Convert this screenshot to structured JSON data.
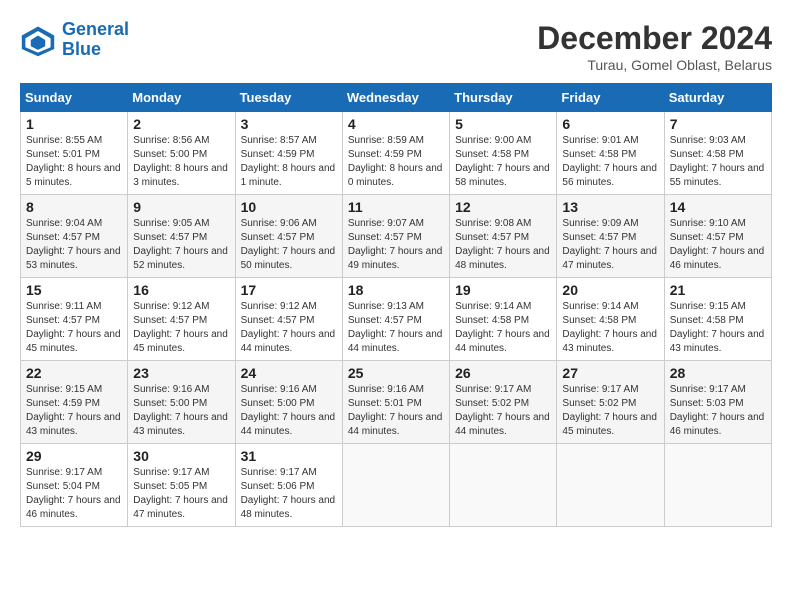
{
  "header": {
    "logo_line1": "General",
    "logo_line2": "Blue",
    "month": "December 2024",
    "location": "Turau, Gomel Oblast, Belarus"
  },
  "days_of_week": [
    "Sunday",
    "Monday",
    "Tuesday",
    "Wednesday",
    "Thursday",
    "Friday",
    "Saturday"
  ],
  "weeks": [
    [
      {
        "day": "1",
        "sunrise": "8:55 AM",
        "sunset": "5:01 PM",
        "daylight": "8 hours and 5 minutes."
      },
      {
        "day": "2",
        "sunrise": "8:56 AM",
        "sunset": "5:00 PM",
        "daylight": "8 hours and 3 minutes."
      },
      {
        "day": "3",
        "sunrise": "8:57 AM",
        "sunset": "4:59 PM",
        "daylight": "8 hours and 1 minute."
      },
      {
        "day": "4",
        "sunrise": "8:59 AM",
        "sunset": "4:59 PM",
        "daylight": "8 hours and 0 minutes."
      },
      {
        "day": "5",
        "sunrise": "9:00 AM",
        "sunset": "4:58 PM",
        "daylight": "7 hours and 58 minutes."
      },
      {
        "day": "6",
        "sunrise": "9:01 AM",
        "sunset": "4:58 PM",
        "daylight": "7 hours and 56 minutes."
      },
      {
        "day": "7",
        "sunrise": "9:03 AM",
        "sunset": "4:58 PM",
        "daylight": "7 hours and 55 minutes."
      }
    ],
    [
      {
        "day": "8",
        "sunrise": "9:04 AM",
        "sunset": "4:57 PM",
        "daylight": "7 hours and 53 minutes."
      },
      {
        "day": "9",
        "sunrise": "9:05 AM",
        "sunset": "4:57 PM",
        "daylight": "7 hours and 52 minutes."
      },
      {
        "day": "10",
        "sunrise": "9:06 AM",
        "sunset": "4:57 PM",
        "daylight": "7 hours and 50 minutes."
      },
      {
        "day": "11",
        "sunrise": "9:07 AM",
        "sunset": "4:57 PM",
        "daylight": "7 hours and 49 minutes."
      },
      {
        "day": "12",
        "sunrise": "9:08 AM",
        "sunset": "4:57 PM",
        "daylight": "7 hours and 48 minutes."
      },
      {
        "day": "13",
        "sunrise": "9:09 AM",
        "sunset": "4:57 PM",
        "daylight": "7 hours and 47 minutes."
      },
      {
        "day": "14",
        "sunrise": "9:10 AM",
        "sunset": "4:57 PM",
        "daylight": "7 hours and 46 minutes."
      }
    ],
    [
      {
        "day": "15",
        "sunrise": "9:11 AM",
        "sunset": "4:57 PM",
        "daylight": "7 hours and 45 minutes."
      },
      {
        "day": "16",
        "sunrise": "9:12 AM",
        "sunset": "4:57 PM",
        "daylight": "7 hours and 45 minutes."
      },
      {
        "day": "17",
        "sunrise": "9:12 AM",
        "sunset": "4:57 PM",
        "daylight": "7 hours and 44 minutes."
      },
      {
        "day": "18",
        "sunrise": "9:13 AM",
        "sunset": "4:57 PM",
        "daylight": "7 hours and 44 minutes."
      },
      {
        "day": "19",
        "sunrise": "9:14 AM",
        "sunset": "4:58 PM",
        "daylight": "7 hours and 44 minutes."
      },
      {
        "day": "20",
        "sunrise": "9:14 AM",
        "sunset": "4:58 PM",
        "daylight": "7 hours and 43 minutes."
      },
      {
        "day": "21",
        "sunrise": "9:15 AM",
        "sunset": "4:58 PM",
        "daylight": "7 hours and 43 minutes."
      }
    ],
    [
      {
        "day": "22",
        "sunrise": "9:15 AM",
        "sunset": "4:59 PM",
        "daylight": "7 hours and 43 minutes."
      },
      {
        "day": "23",
        "sunrise": "9:16 AM",
        "sunset": "5:00 PM",
        "daylight": "7 hours and 43 minutes."
      },
      {
        "day": "24",
        "sunrise": "9:16 AM",
        "sunset": "5:00 PM",
        "daylight": "7 hours and 44 minutes."
      },
      {
        "day": "25",
        "sunrise": "9:16 AM",
        "sunset": "5:01 PM",
        "daylight": "7 hours and 44 minutes."
      },
      {
        "day": "26",
        "sunrise": "9:17 AM",
        "sunset": "5:02 PM",
        "daylight": "7 hours and 44 minutes."
      },
      {
        "day": "27",
        "sunrise": "9:17 AM",
        "sunset": "5:02 PM",
        "daylight": "7 hours and 45 minutes."
      },
      {
        "day": "28",
        "sunrise": "9:17 AM",
        "sunset": "5:03 PM",
        "daylight": "7 hours and 46 minutes."
      }
    ],
    [
      {
        "day": "29",
        "sunrise": "9:17 AM",
        "sunset": "5:04 PM",
        "daylight": "7 hours and 46 minutes."
      },
      {
        "day": "30",
        "sunrise": "9:17 AM",
        "sunset": "5:05 PM",
        "daylight": "7 hours and 47 minutes."
      },
      {
        "day": "31",
        "sunrise": "9:17 AM",
        "sunset": "5:06 PM",
        "daylight": "7 hours and 48 minutes."
      },
      null,
      null,
      null,
      null
    ]
  ]
}
